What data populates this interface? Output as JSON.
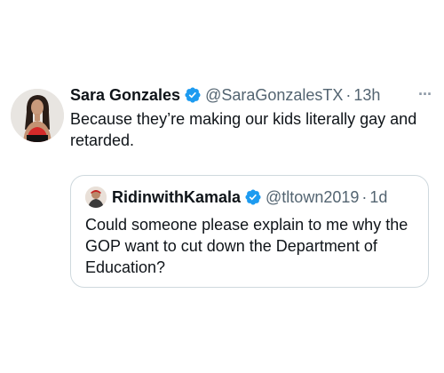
{
  "tweet": {
    "author_name": "Sara Gonzales",
    "author_handle": "@SaraGonzalesTX",
    "separator": "·",
    "time": "13h",
    "more": "···",
    "text": "Because they’re making our kids literally gay and retarded.",
    "avatar_icon": "profile-photo-woman"
  },
  "quoted_tweet": {
    "author_name": "RidinwithKamala",
    "author_handle": "@tltown2019",
    "separator": "·",
    "time": "1d",
    "text": "Could someone please explain to me why the GOP want to cut down the Department of Education?",
    "avatar_icon": "profile-photo-man"
  },
  "colors": {
    "text": "#0f1419",
    "secondary": "#536471",
    "verified": "#1d9bf0",
    "border": "#cfd9de"
  }
}
